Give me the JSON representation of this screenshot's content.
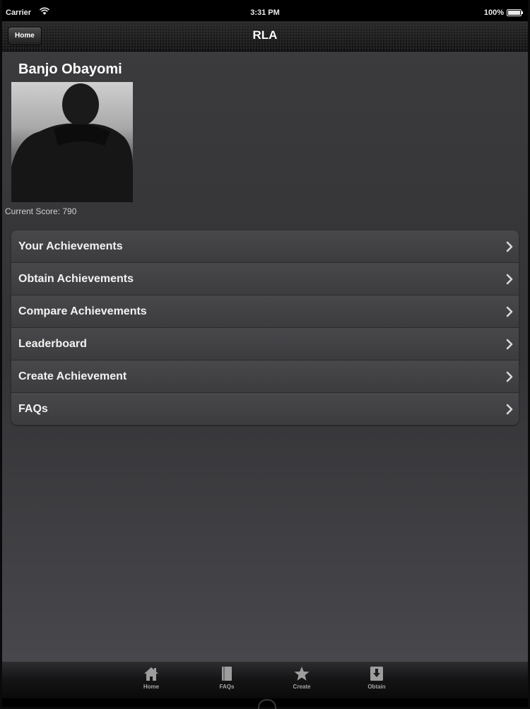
{
  "status_bar": {
    "carrier": "Carrier",
    "time": "3:31 PM",
    "battery": "100%"
  },
  "nav": {
    "back_label": "Home",
    "title": "RLA"
  },
  "profile": {
    "name": "Banjo Obayomi",
    "score_label": "Current Score: 790"
  },
  "menu": {
    "items": [
      {
        "label": "Your Achievements"
      },
      {
        "label": "Obtain Achievements"
      },
      {
        "label": "Compare Achievements"
      },
      {
        "label": "Leaderboard"
      },
      {
        "label": "Create Achievement"
      },
      {
        "label": "FAQs"
      }
    ]
  },
  "tab_bar": {
    "tabs": [
      {
        "label": "Home",
        "icon": "house-icon"
      },
      {
        "label": "FAQs",
        "icon": "book-icon"
      },
      {
        "label": "Create",
        "icon": "star-icon"
      },
      {
        "label": "Obtain",
        "icon": "download-icon"
      }
    ]
  },
  "colors": {
    "background": "#38383b",
    "nav_bar": "#1e1e1e",
    "menu_row": "#444447",
    "tab_label": "#a6a6a6"
  }
}
